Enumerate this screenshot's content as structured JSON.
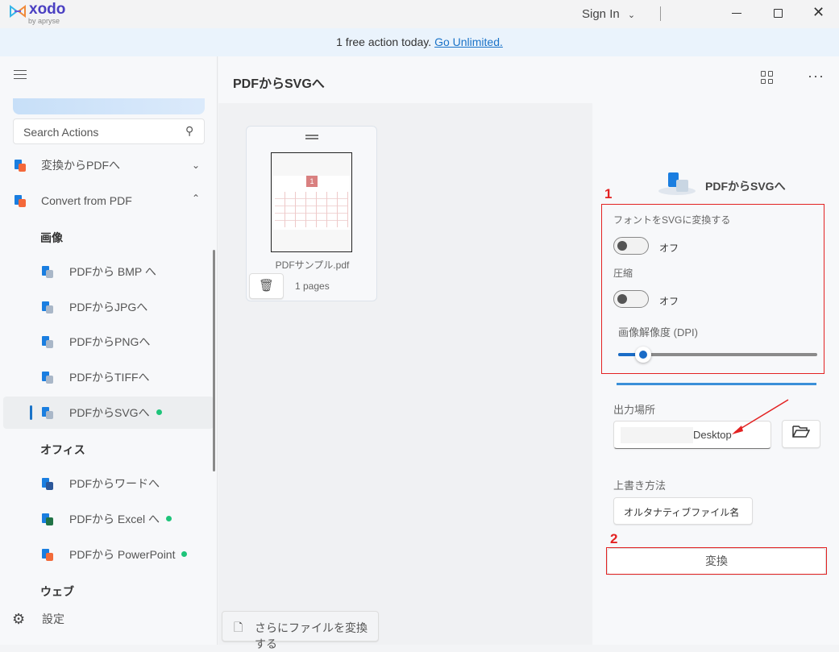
{
  "app": {
    "logo_text": "xodo",
    "logo_sub": "by apryse",
    "sign_in": "Sign In"
  },
  "banner": {
    "text": "1 free action today. ",
    "link": "Go Unlimited."
  },
  "sidebar": {
    "search_placeholder": "Search Actions",
    "groups": [
      {
        "label": "変換からPDFへ",
        "expanded": false
      },
      {
        "label": "Convert from PDF",
        "expanded": true
      }
    ],
    "sections": {
      "image": "画像",
      "office": "オフィス",
      "web": "ウェブ"
    },
    "items": [
      {
        "label": "PDFから BMP へ"
      },
      {
        "label": "PDFからJPGへ"
      },
      {
        "label": "PDFからPNGへ"
      },
      {
        "label": "PDFからTIFFへ"
      },
      {
        "label": "PDFからSVGへ",
        "active": true,
        "new": true
      },
      {
        "label": "PDFからワードへ"
      },
      {
        "label": "PDFから Excel へ",
        "new": true
      },
      {
        "label": "PDFから PowerPoint",
        "new": true
      }
    ],
    "settings": "設定"
  },
  "main": {
    "title": "PDFからSVGへ",
    "file": {
      "name": "PDFサンプル.pdf",
      "pages": "1 pages",
      "thumb_day": "1"
    },
    "add_files": "さらにファイルを変換する"
  },
  "panel": {
    "title": "PDFからSVGへ",
    "font_to_svg": {
      "label": "フォントをSVGに変換する",
      "state": "オフ",
      "on": false
    },
    "compress": {
      "label": "圧縮",
      "state": "オフ",
      "on": false
    },
    "dpi": {
      "label": "画像解像度 (DPI)",
      "fraction": 0.06
    },
    "output": {
      "label": "出力場所",
      "value": "Desktop"
    },
    "overwrite": {
      "label": "上書き方法",
      "value": "オルタナティブファイル名"
    },
    "convert": "変換"
  },
  "annotations": {
    "n1": "1",
    "n2": "2",
    "color": "#e32222"
  },
  "colors": {
    "accent": "#1a73c8",
    "new_dot": "#1ec47a"
  }
}
